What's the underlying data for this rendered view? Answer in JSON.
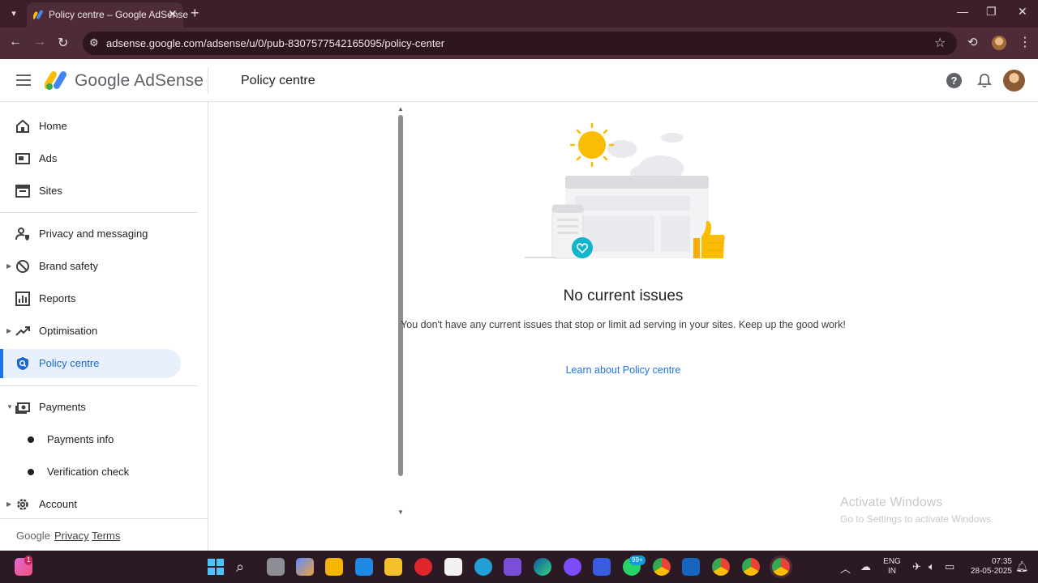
{
  "browser": {
    "tab_title": "Policy centre – Google AdSense",
    "url": "adsense.google.com/adsense/u/0/pub-8307577542165095/policy-center"
  },
  "header": {
    "brand": "Google AdSense",
    "page_title": "Policy centre"
  },
  "sidebar": {
    "items": [
      {
        "label": "Home"
      },
      {
        "label": "Ads"
      },
      {
        "label": "Sites"
      },
      {
        "label": "Privacy and messaging"
      },
      {
        "label": "Brand safety"
      },
      {
        "label": "Reports"
      },
      {
        "label": "Optimisation"
      },
      {
        "label": "Policy centre"
      },
      {
        "label": "Payments"
      },
      {
        "label": "Payments info"
      },
      {
        "label": "Verification check"
      },
      {
        "label": "Account"
      }
    ],
    "footer": {
      "google": "Google",
      "privacy": "Privacy",
      "terms": "Terms"
    }
  },
  "main": {
    "headline": "No current issues",
    "message": "You don't have any current issues that stop or limit ad serving in your sites. Keep up the good work!",
    "link": "Learn about Policy centre"
  },
  "watermark": {
    "title": "Activate Windows",
    "subtitle": "Go to Settings to activate Windows."
  },
  "taskbar": {
    "notification_badge": "1",
    "whatsapp_badge": "99+",
    "language": "ENG",
    "region": "IN",
    "time": "07:35",
    "date": "28-05-2025"
  },
  "colors": {
    "accent": "#1a73e8",
    "active_bg": "#e8f0fe",
    "chrome_bg": "#4d2b38"
  }
}
